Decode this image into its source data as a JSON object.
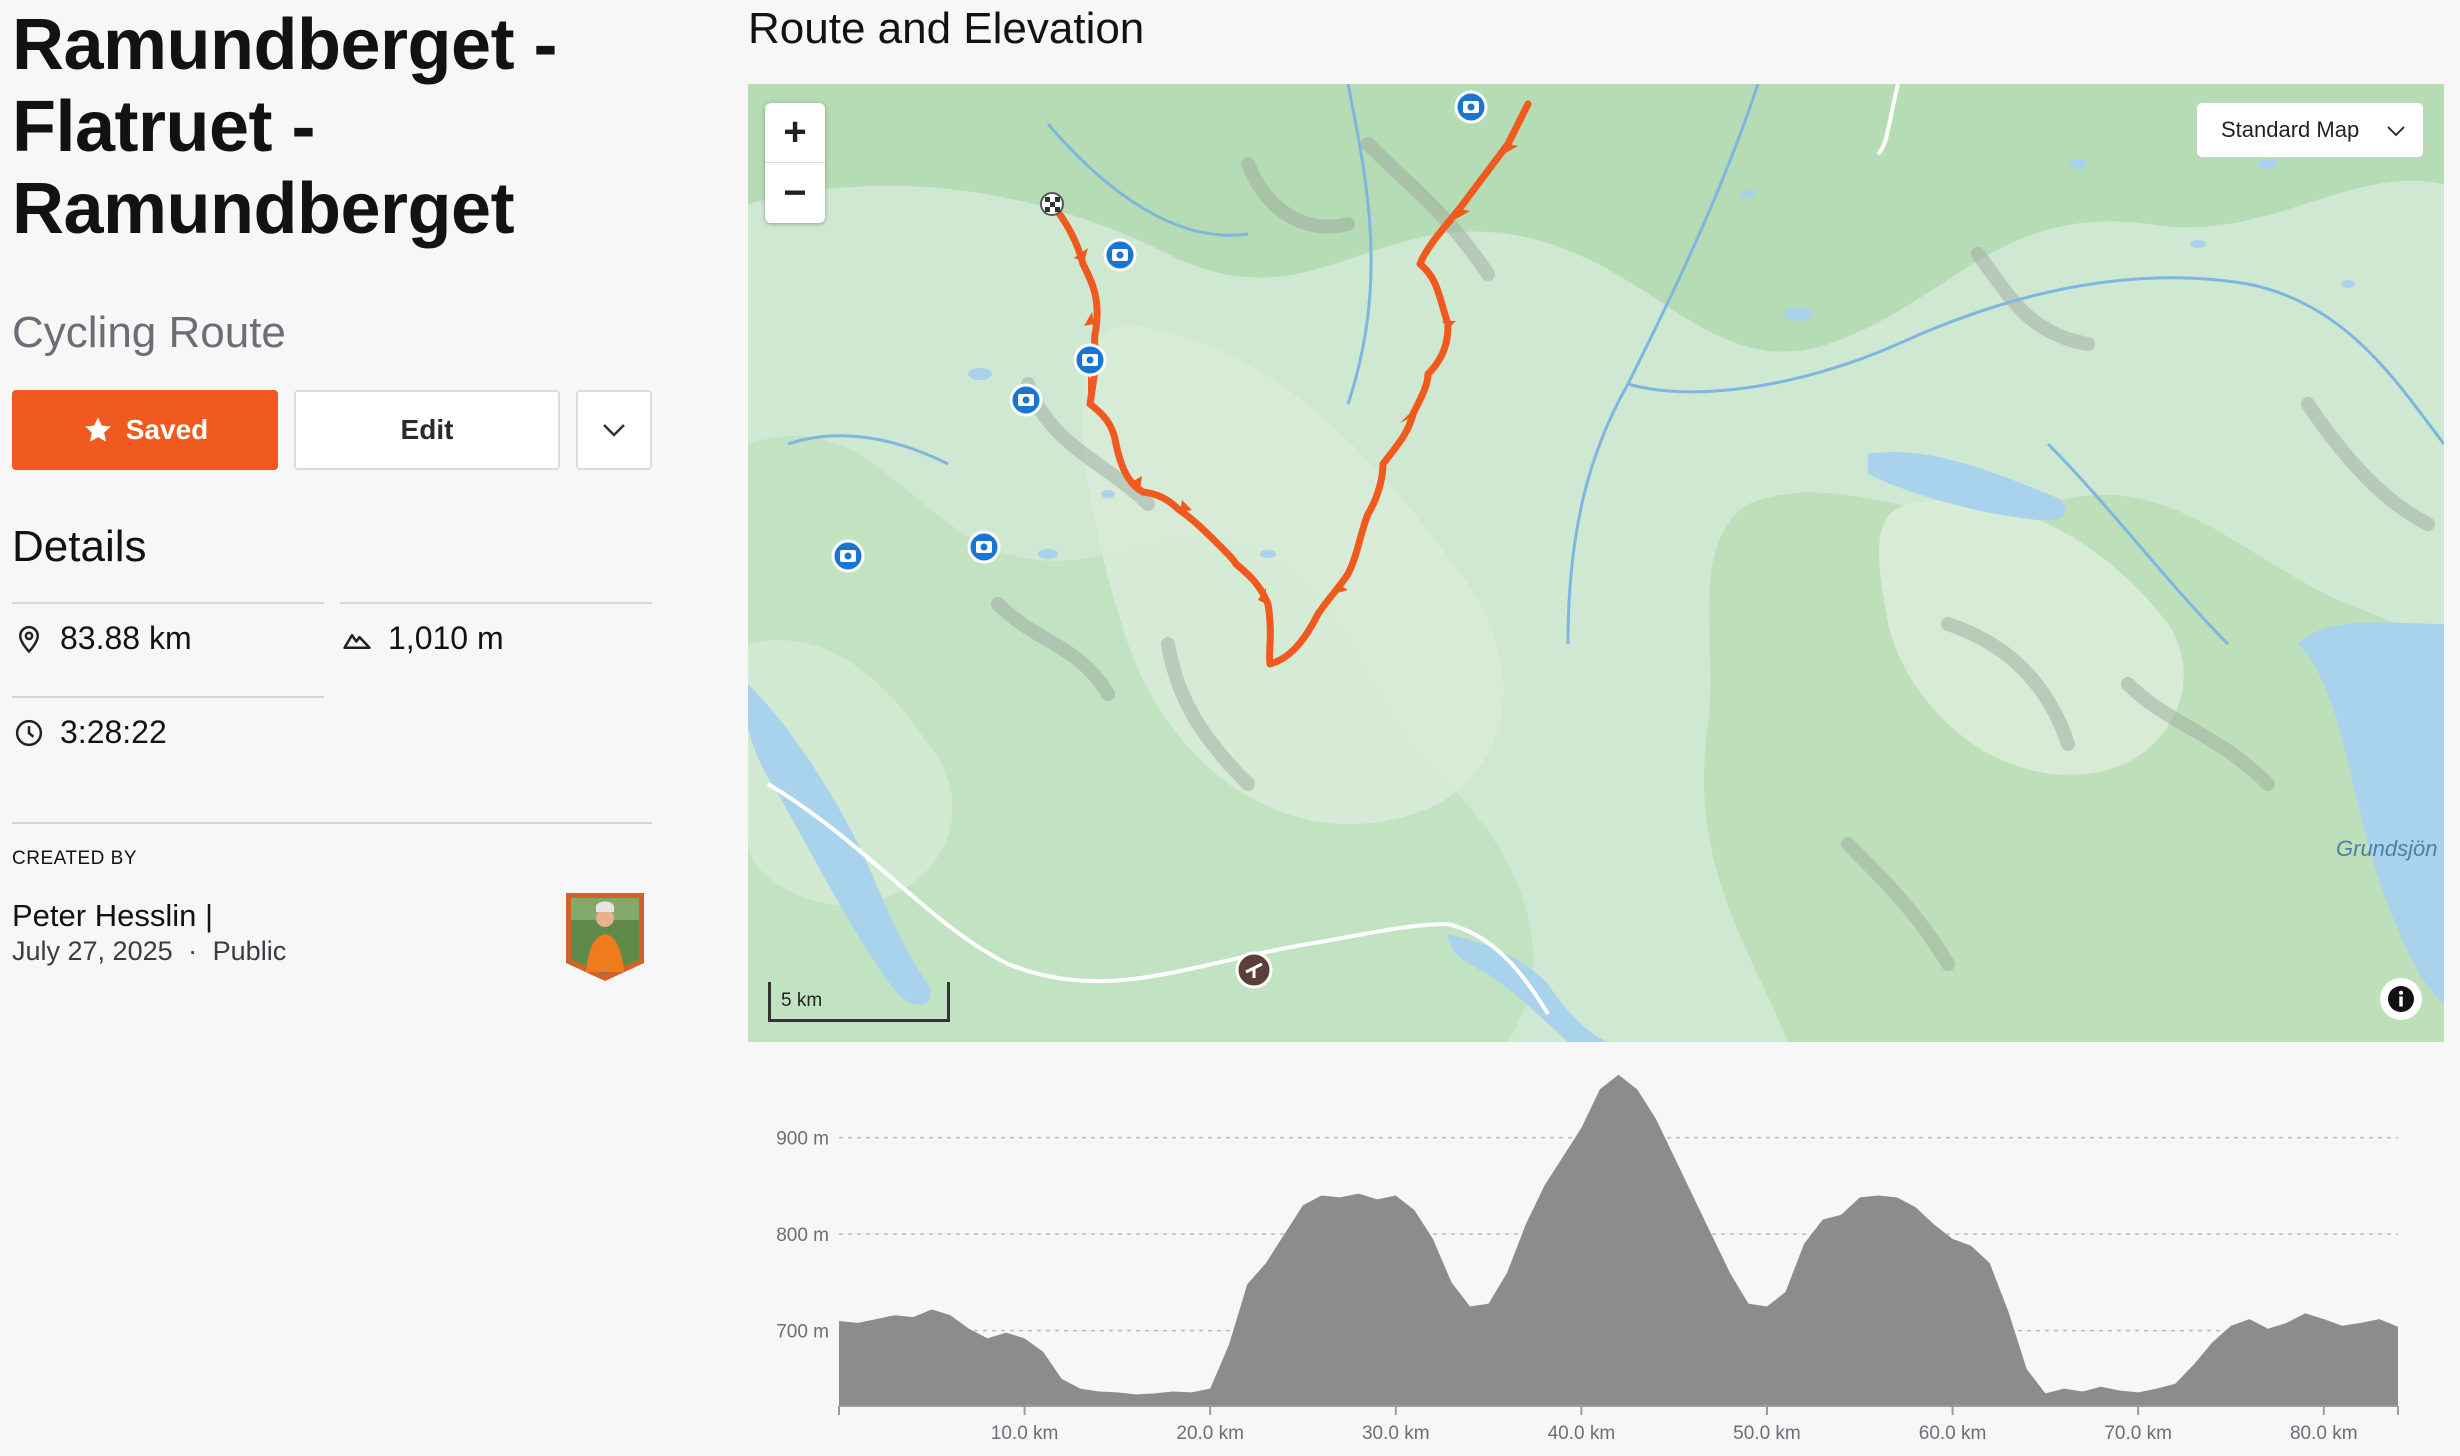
{
  "route": {
    "title": "Ramundberget - Flatruet - Ramundberget",
    "type": "Cycling Route"
  },
  "actions": {
    "saved_label": "Saved",
    "edit_label": "Edit"
  },
  "details": {
    "heading": "Details",
    "distance": "83.88 km",
    "elevation_gain": "1,010 m",
    "moving_time": "3:28:22"
  },
  "creator": {
    "label": "CREATED BY",
    "name": "Peter Hesslin |",
    "date": "July 27, 2025",
    "separator": "·",
    "visibility": "Public"
  },
  "map": {
    "section_title": "Route and Elevation",
    "map_type": "Standard Map",
    "scale_label": "5 km",
    "lake_label": "Grundsjön",
    "route_color": "#f05a1e",
    "zoom_in": "+",
    "zoom_out": "−",
    "photo_marker_count": 7
  },
  "chart_data": {
    "type": "area",
    "title": "",
    "xlabel": "",
    "ylabel": "",
    "x_unit": "km",
    "y_unit": "m",
    "xlim": [
      0,
      84
    ],
    "ylim": [
      623,
      970
    ],
    "x_ticks": [
      "10.0 km",
      "20.0 km",
      "30.0 km",
      "40.0 km",
      "50.0 km",
      "60.0 km",
      "70.0 km",
      "80.0 km"
    ],
    "x_tick_values": [
      10,
      20,
      30,
      40,
      50,
      60,
      70,
      80
    ],
    "y_ticks": [
      "700 m",
      "800 m",
      "900 m"
    ],
    "y_tick_values": [
      700,
      800,
      900
    ],
    "grid": true,
    "fill_color": "#8c8c8c",
    "series": [
      {
        "x": [
          0,
          1,
          2,
          3,
          4,
          5,
          6,
          7,
          8,
          9,
          10,
          11,
          12,
          13,
          14,
          15,
          16,
          17,
          18,
          19,
          20,
          21,
          22,
          23,
          24,
          25,
          26,
          27,
          28,
          29,
          30,
          31,
          32,
          33,
          34,
          35,
          36,
          37,
          38,
          39,
          40,
          41,
          42,
          43,
          44,
          45,
          46,
          47,
          48,
          49,
          50,
          51,
          52,
          53,
          54,
          55,
          56,
          57,
          58,
          59,
          60,
          61,
          62,
          63,
          64,
          65,
          66,
          67,
          68,
          69,
          70,
          71,
          72,
          73,
          74,
          75,
          76,
          77,
          78,
          79,
          80,
          81,
          82,
          83,
          84
        ],
        "y": [
          710,
          708,
          712,
          716,
          714,
          722,
          716,
          702,
          692,
          698,
          692,
          678,
          650,
          640,
          637,
          636,
          634,
          635,
          637,
          636,
          640,
          685,
          748,
          770,
          800,
          830,
          840,
          838,
          842,
          836,
          840,
          825,
          795,
          750,
          725,
          728,
          760,
          810,
          850,
          880,
          910,
          950,
          965,
          950,
          920,
          880,
          840,
          800,
          760,
          728,
          725,
          740,
          790,
          815,
          820,
          838,
          840,
          838,
          828,
          810,
          795,
          788,
          770,
          720,
          660,
          635,
          640,
          637,
          642,
          638,
          636,
          640,
          645,
          665,
          688,
          705,
          712,
          702,
          708,
          718,
          712,
          705,
          708,
          712,
          704
        ]
      }
    ]
  }
}
